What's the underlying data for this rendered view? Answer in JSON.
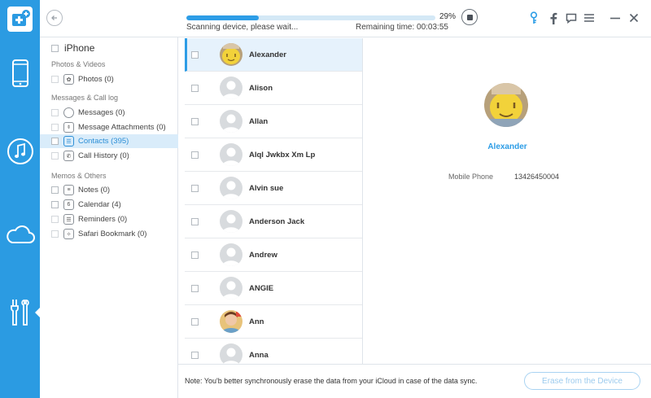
{
  "topbar": {
    "progress_percent": 29,
    "progress_label": "29%",
    "scan_status": "Scanning device, please wait...",
    "remaining": "Remaining time: 00:03:55"
  },
  "rail": {
    "items": [
      "phone-icon",
      "music-icon",
      "cloud-icon",
      "tools-icon"
    ],
    "active": "tools-icon"
  },
  "categories": {
    "root": "iPhone",
    "sections": [
      {
        "title": "Photos & Videos",
        "items": [
          {
            "label": "Photos (0)",
            "icon": "photos-icon"
          }
        ]
      },
      {
        "title": "Messages & Call log",
        "items": [
          {
            "label": "Messages (0)",
            "icon": "messages-icon"
          },
          {
            "label": "Message Attachments (0)",
            "icon": "attachment-icon"
          },
          {
            "label": "Contacts (395)",
            "icon": "contacts-icon"
          },
          {
            "label": "Call History (0)",
            "icon": "call-history-icon"
          }
        ]
      },
      {
        "title": "Memos & Others",
        "items": [
          {
            "label": "Notes (0)",
            "icon": "notes-icon"
          },
          {
            "label": "Calendar (4)",
            "icon": "calendar-icon"
          },
          {
            "label": "Reminders (0)",
            "icon": "reminders-icon"
          },
          {
            "label": "Safari Bookmark (0)",
            "icon": "bookmark-icon"
          }
        ]
      }
    ],
    "active": "Contacts (395)",
    "calendar_glyph": "6"
  },
  "contacts": [
    {
      "name": "Alexander",
      "avatar": "photo-yellow"
    },
    {
      "name": "Alison",
      "avatar": "default"
    },
    {
      "name": "Allan",
      "avatar": "default"
    },
    {
      "name": "Alql Jwkbx Xm Lp",
      "avatar": "default"
    },
    {
      "name": "Alvin sue",
      "avatar": "default"
    },
    {
      "name": "Anderson Jack",
      "avatar": "default"
    },
    {
      "name": "Andrew",
      "avatar": "default"
    },
    {
      "name": "ANGIE",
      "avatar": "default"
    },
    {
      "name": "Ann",
      "avatar": "photo-child"
    },
    {
      "name": "Anna",
      "avatar": "default"
    }
  ],
  "detail": {
    "name": "Alexander",
    "fields": [
      {
        "label": "Mobile Phone",
        "value": "13426450004"
      }
    ]
  },
  "footer": {
    "note": "Note: You'b better synchronously erase the data from your iCloud in case of the data sync.",
    "erase_label": "Erase from the Device"
  },
  "colors": {
    "accent": "#2d9de6",
    "rail": "#2b9be2"
  }
}
